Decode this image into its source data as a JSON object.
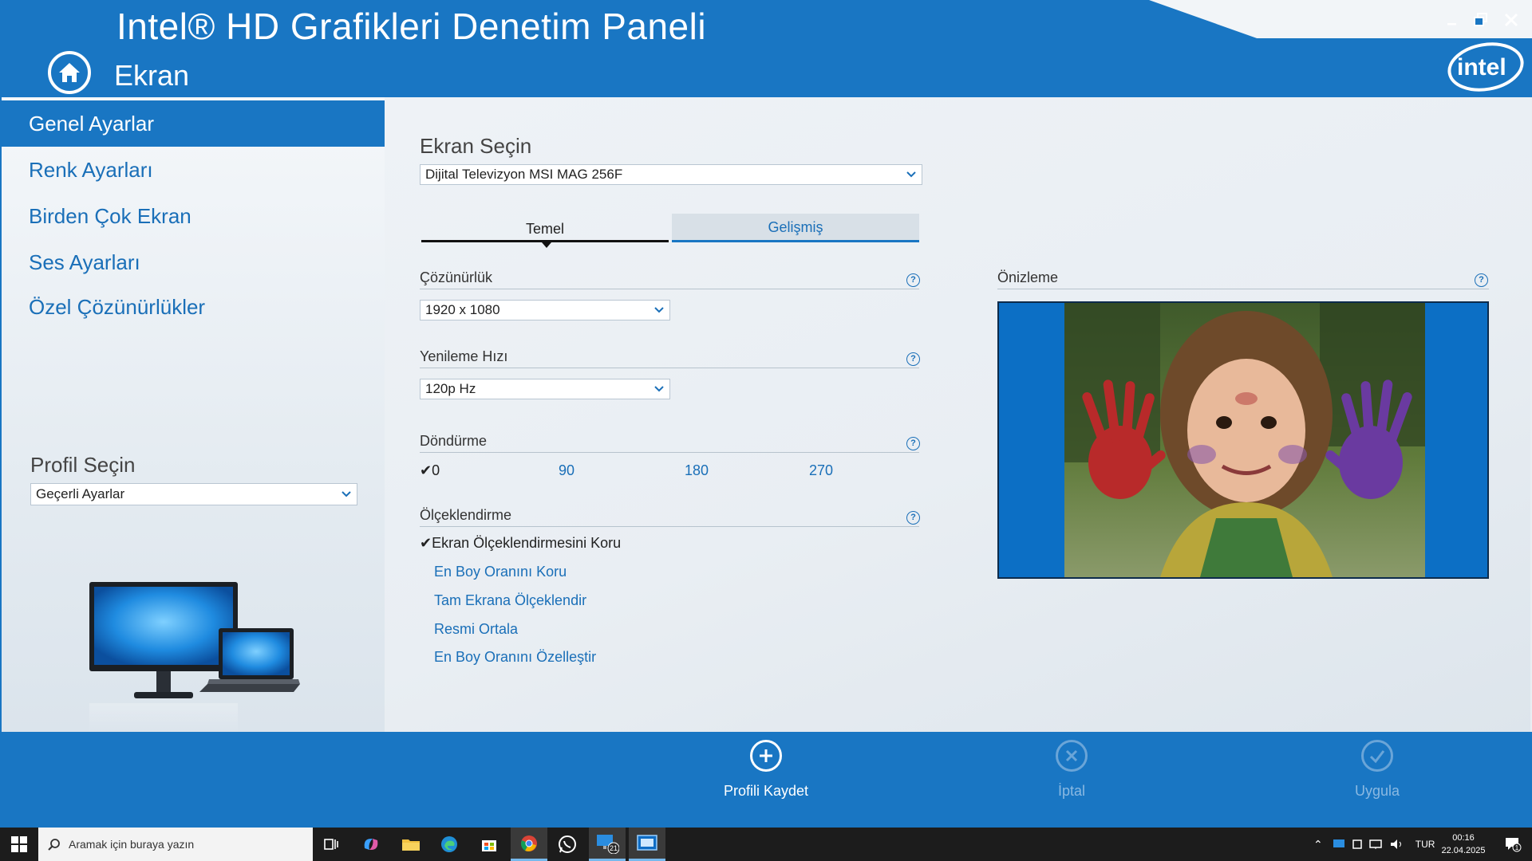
{
  "window": {
    "title": "Intel® HD Grafikleri Denetim Paneli",
    "section": "Ekran",
    "controls": {
      "minimize": "minimize-icon",
      "restore": "restore-icon",
      "close": "close-icon"
    },
    "logo": "intel"
  },
  "sidebar": {
    "items": [
      {
        "label": "Genel Ayarlar",
        "active": true
      },
      {
        "label": "Renk Ayarları",
        "active": false
      },
      {
        "label": "Birden Çok Ekran",
        "active": false
      },
      {
        "label": "Ses Ayarları",
        "active": false
      },
      {
        "label": "Özel Çözünürlükler",
        "active": false
      }
    ],
    "profile": {
      "label": "Profil Seçin",
      "selected": "Geçerli Ayarlar"
    }
  },
  "main": {
    "display_select": {
      "label": "Ekran Seçin",
      "selected": "Dijital Televizyon MSI MAG 256F"
    },
    "tabs": [
      {
        "label": "Temel",
        "active": true
      },
      {
        "label": "Gelişmiş",
        "active": false
      }
    ],
    "resolution": {
      "label": "Çözünürlük",
      "selected": "1920 x 1080"
    },
    "refresh_rate": {
      "label": "Yenileme Hızı",
      "selected": "120p Hz"
    },
    "rotation": {
      "label": "Döndürme",
      "options": [
        "0",
        "90",
        "180",
        "270"
      ],
      "selected": "0"
    },
    "scaling": {
      "label": "Ölçeklendirme",
      "options": [
        "Ekran Ölçeklendirmesini Koru",
        "En Boy Oranını Koru",
        "Tam Ekrana Ölçeklendir",
        "Resmi Ortala",
        "En Boy Oranını Özelleştir"
      ],
      "selected": "Ekran Ölçeklendirmesini Koru"
    },
    "preview": {
      "label": "Önizleme"
    },
    "help_symbol": "?"
  },
  "actions": {
    "save_profile": {
      "label": "Profili Kaydet",
      "enabled": true
    },
    "cancel": {
      "label": "İptal",
      "enabled": false
    },
    "apply": {
      "label": "Uygula",
      "enabled": false
    }
  },
  "taskbar": {
    "search_placeholder": "Aramak için buraya yazın",
    "apps": [
      "task-view-icon",
      "copilot-icon",
      "file-explorer-icon",
      "edge-icon",
      "store-icon",
      "chrome-icon",
      "whatsapp-icon",
      "monitor-app-icon",
      "intel-graphics-icon"
    ],
    "badge": "21",
    "language": "TUR",
    "time": "00:16",
    "date": "22.04.2025",
    "notification_count": "1"
  },
  "colors": {
    "accent": "#1976c3",
    "link": "#1a6fb8",
    "taskbar": "#1c1c1c"
  }
}
